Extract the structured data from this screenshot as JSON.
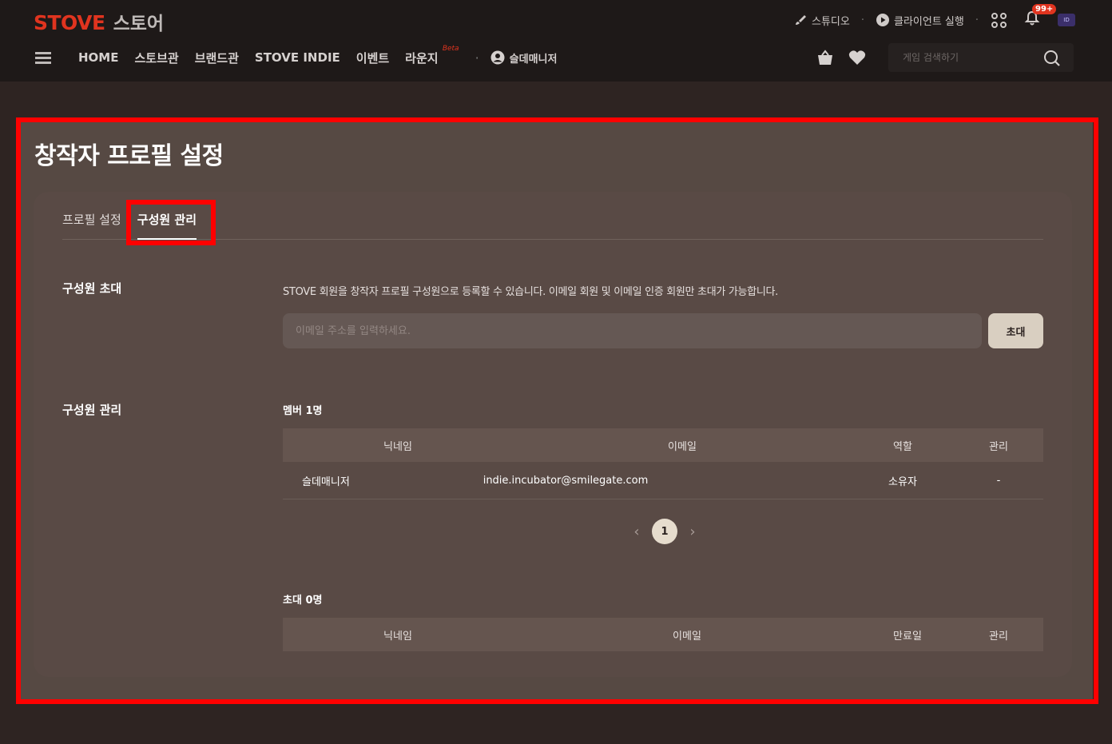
{
  "header": {
    "logo_main": "STOVE",
    "logo_sub": "스토어",
    "util": {
      "studio": "스튜디오",
      "client": "클라이언트 실행",
      "notif_badge": "99+",
      "avatar_text": "ID"
    },
    "nav": {
      "items": [
        "HOME",
        "스토브관",
        "브랜드관",
        "STOVE INDIE",
        "이벤트",
        "라운지"
      ],
      "beta": "Beta",
      "user": "슬데매니저"
    },
    "search_placeholder": "게임 검색하기"
  },
  "page": {
    "title": "창작자 프로필 설정",
    "tabs": [
      {
        "label": "프로필 설정",
        "active": false
      },
      {
        "label": "구성원 관리",
        "active": true
      }
    ],
    "invite": {
      "label": "구성원 초대",
      "description": "STOVE 회원을 창작자 프로필 구성원으로 등록할 수 있습니다. 이메일 회원 및 이메일 인증 회원만 초대가 가능합니다.",
      "placeholder": "이메일 주소를 입력하세요.",
      "button": "초대"
    },
    "manage": {
      "label": "구성원 관리",
      "members_count": "멤버 1명",
      "members_headers": [
        "닉네임",
        "이메일",
        "역할",
        "관리"
      ],
      "members_rows": [
        {
          "nickname": "슬데매니저",
          "email": "indie.incubator@smilegate.com",
          "role": "소유자",
          "manage": "-"
        }
      ],
      "pagination": {
        "prev": "‹",
        "page": "1",
        "next": "›"
      },
      "invites_count": "초대 0명",
      "invites_headers": [
        "닉네임",
        "이메일",
        "만료일",
        "관리"
      ]
    }
  },
  "colors": {
    "accent": "#e0341f",
    "highlight": "#ff0000",
    "panel": "#594a45"
  }
}
